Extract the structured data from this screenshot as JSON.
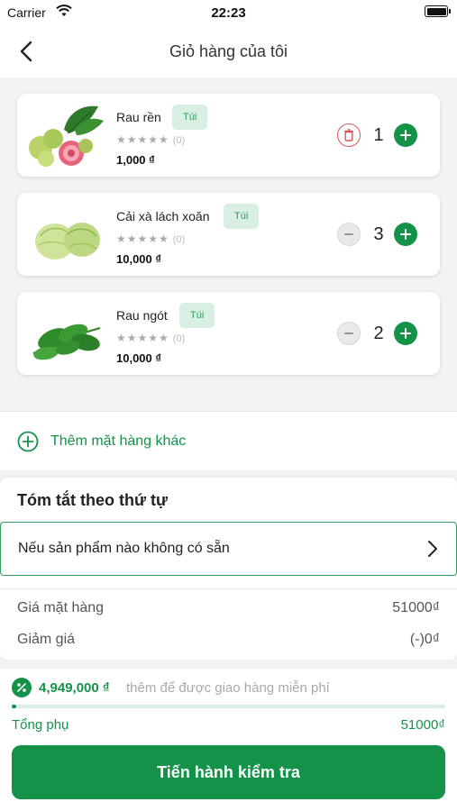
{
  "status_bar": {
    "carrier": "Carrier",
    "time": "22:23"
  },
  "header": {
    "title": "Giỏ hàng của tôi"
  },
  "cart": {
    "items": [
      {
        "name": "Rau rền",
        "unit": "Túi",
        "stars": "★★★★★",
        "rating_count": "(0)",
        "price": "1,000 ₫",
        "quantity": "1"
      },
      {
        "name": "Cải xà lách xoăn",
        "unit": "Túi",
        "stars": "★★★★★",
        "rating_count": "(0)",
        "price": "10,000 ₫",
        "quantity": "3"
      },
      {
        "name": "Rau ngót",
        "unit": "Túi",
        "stars": "★★★★★",
        "rating_count": "(0)",
        "price": "10,000 ₫",
        "quantity": "2"
      }
    ]
  },
  "add_more": {
    "label": "Thêm mặt hàng khác"
  },
  "summary": {
    "title": "Tóm tắt theo thứ tự",
    "unavailable_label": "Nếu sản phẩm nào không có sẵn",
    "item_price_label": "Giá mặt hàng",
    "item_price_value": "51000₫",
    "discount_label": "Giảm giá",
    "discount_value": "(-)0₫"
  },
  "footer": {
    "promo_amount": "4,949,000 ₫",
    "promo_text": "thêm để được giao hàng miễn phí",
    "free_shipping_progress": 0.01,
    "subtotal_label": "Tổng phụ",
    "subtotal_value": "51000₫",
    "checkout_label": "Tiến hành kiểm tra"
  },
  "colors": {
    "accent": "#14924a",
    "badge_bg": "#d8efe2",
    "danger": "#e05454"
  },
  "icons": [
    "wifi-icon",
    "battery-icon",
    "back-chevron-icon",
    "trash-icon",
    "minus-icon",
    "plus-icon",
    "plus-circle-icon",
    "chevron-right-icon",
    "percent-icon"
  ]
}
